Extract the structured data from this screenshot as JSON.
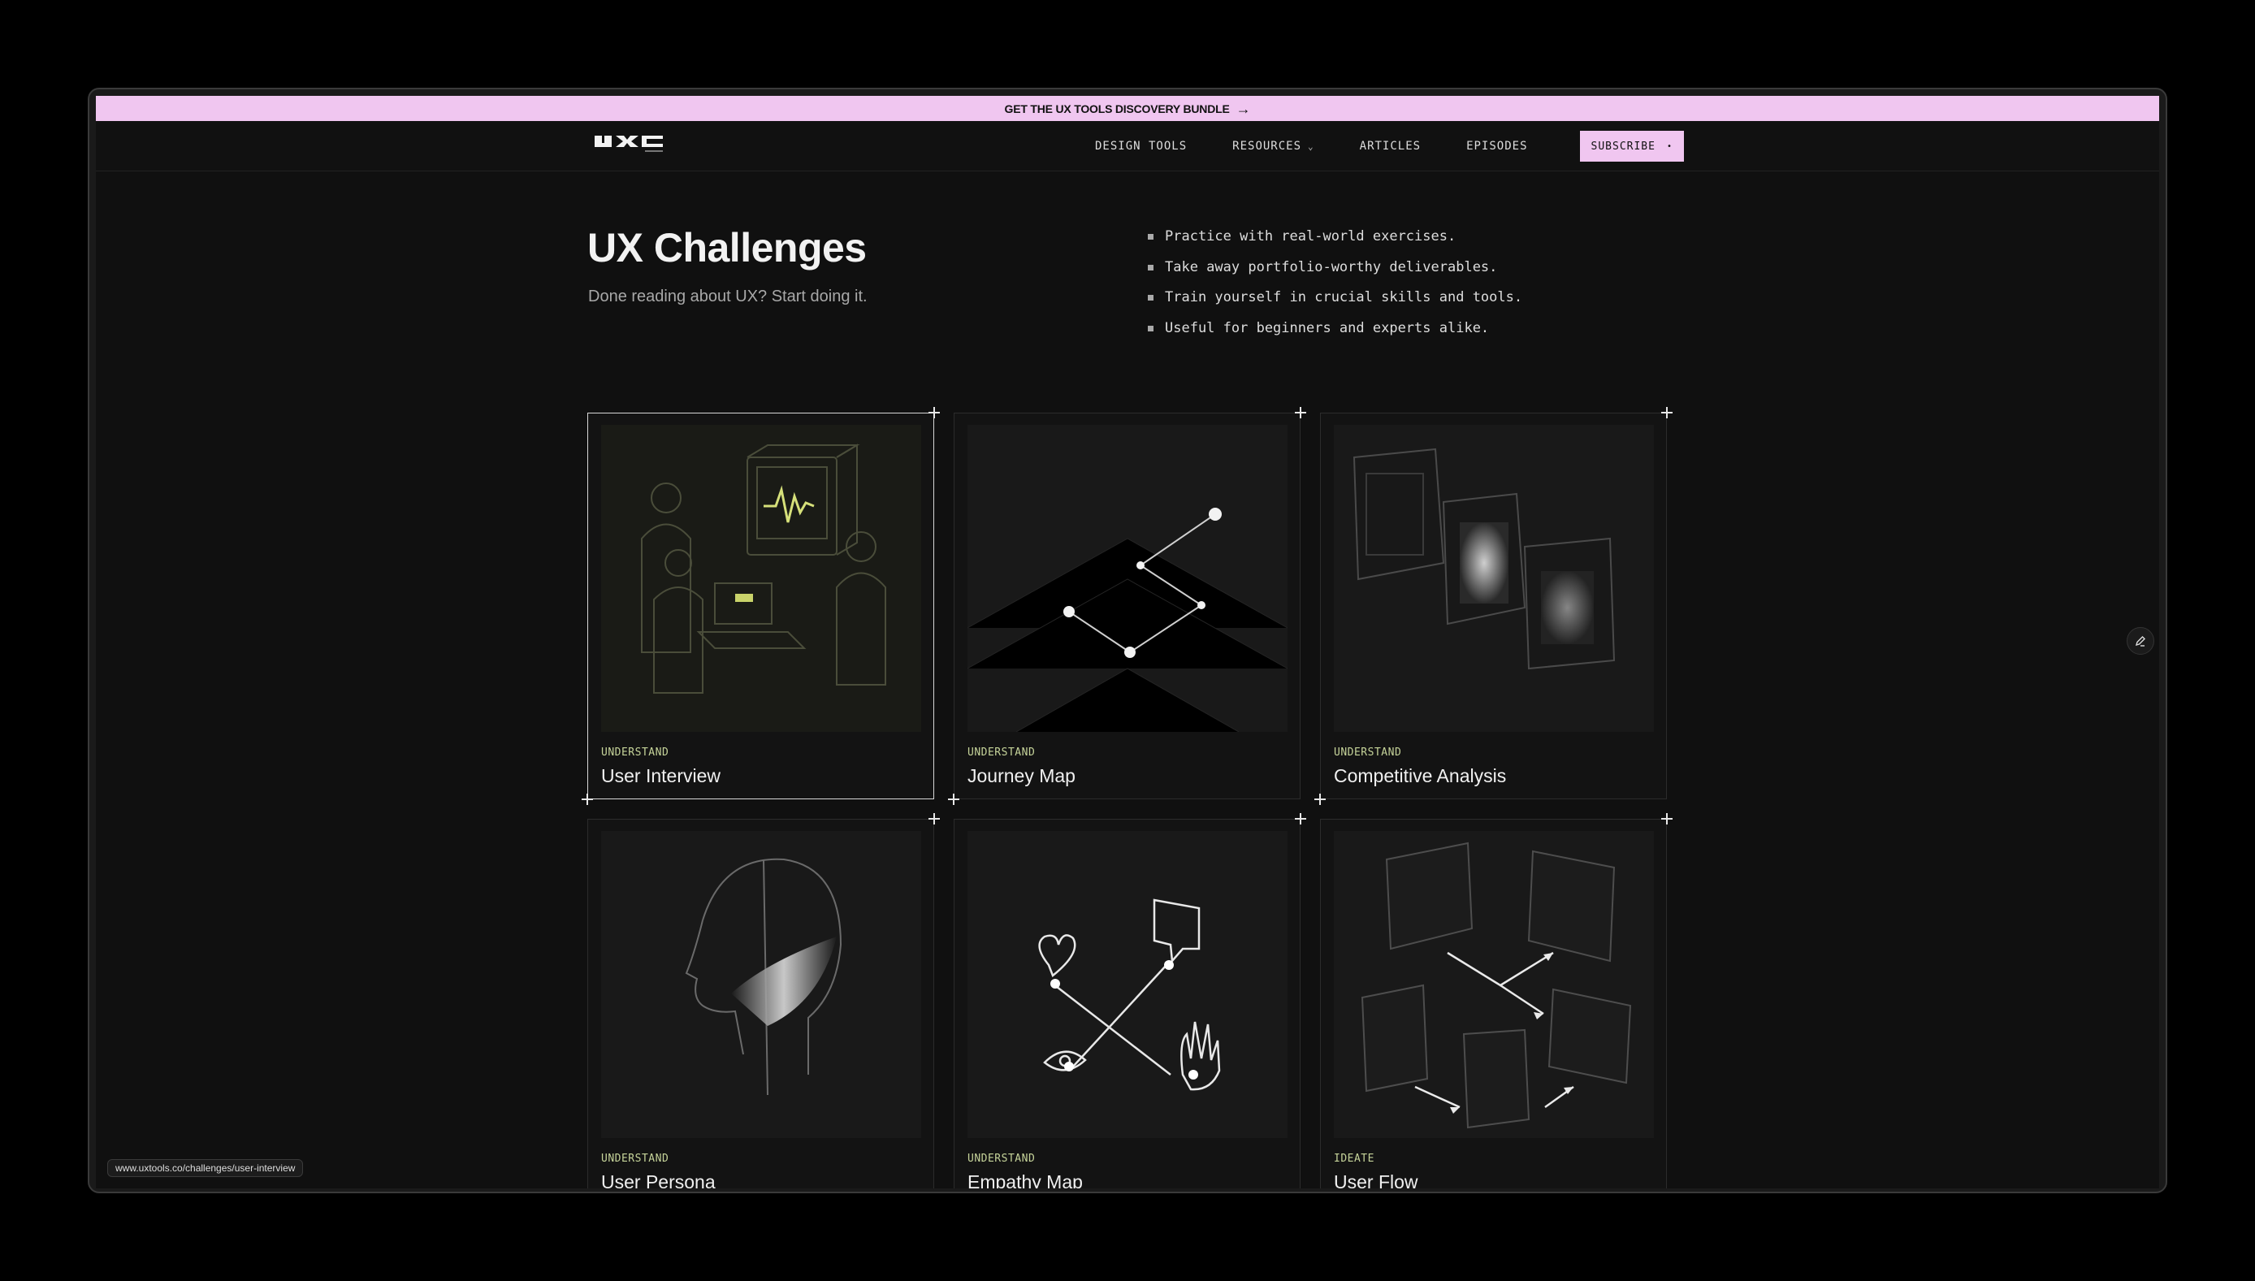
{
  "banner": {
    "text": "GET THE UX TOOLS DISCOVERY BUNDLE",
    "arrow": "→"
  },
  "nav": {
    "logo": "uxtools-logo",
    "links": [
      {
        "label": "DESIGN TOOLS"
      },
      {
        "label": "RESOURCES",
        "dropdown": true
      },
      {
        "label": "ARTICLES"
      },
      {
        "label": "EPISODES"
      }
    ],
    "subscribe": "SUBSCRIBE"
  },
  "hero": {
    "title": "UX Challenges",
    "subtitle": "Done reading about UX? Start doing it.",
    "bullets": [
      "Practice with real-world exercises.",
      "Take away portfolio-worthy deliverables.",
      "Train yourself in crucial skills and tools.",
      "Useful for beginners and experts alike."
    ]
  },
  "cards": [
    {
      "category": "UNDERSTAND",
      "title": "User Interview",
      "icon": "user-interview-illustration"
    },
    {
      "category": "UNDERSTAND",
      "title": "Journey Map",
      "icon": "journey-map-illustration"
    },
    {
      "category": "UNDERSTAND",
      "title": "Competitive Analysis",
      "icon": "competitive-analysis-illustration"
    },
    {
      "category": "UNDERSTAND",
      "title": "User Persona",
      "icon": "user-persona-illustration"
    },
    {
      "category": "UNDERSTAND",
      "title": "Empathy Map",
      "icon": "empathy-map-illustration"
    },
    {
      "category": "IDEATE",
      "title": "User Flow",
      "icon": "user-flow-illustration"
    }
  ],
  "status_url": "www.uxtools.co/challenges/user-interview",
  "colors": {
    "accent_pink": "#f0c6f0",
    "category_green": "#c6d49a",
    "background": "#101010"
  }
}
